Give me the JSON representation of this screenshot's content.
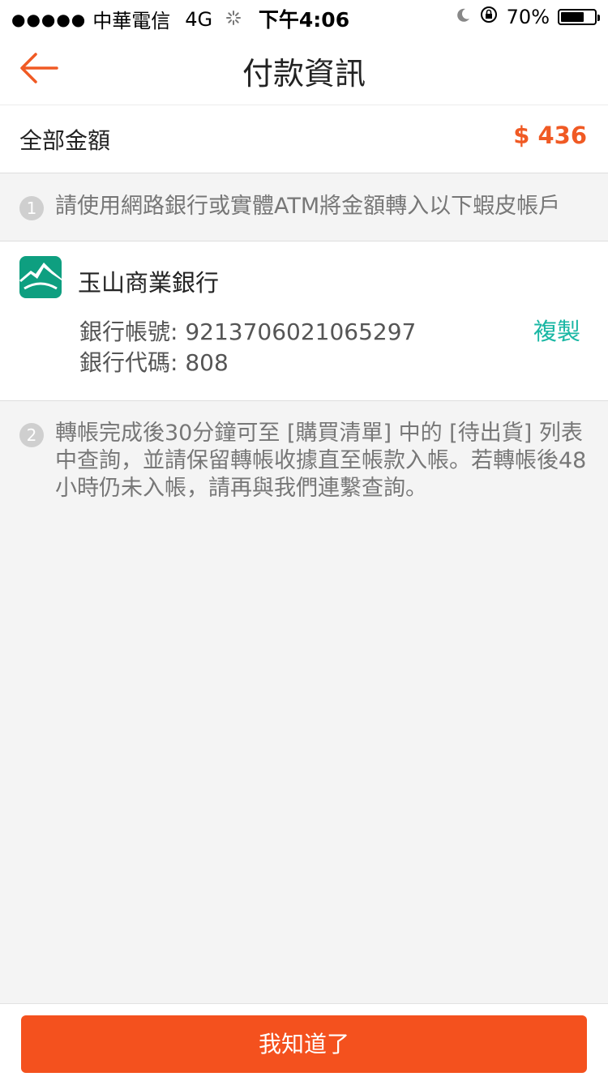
{
  "status_bar": {
    "signal": "●●●●●",
    "carrier": "中華電信",
    "network": "4G",
    "time": "下午4:06",
    "battery_text": "70%",
    "battery_level": 0.7
  },
  "header": {
    "title": "付款資訊",
    "back_icon": "arrow-left-icon",
    "accent_color": "#f05a24"
  },
  "total": {
    "label": "全部金額",
    "amount": "$ 436"
  },
  "step1": {
    "number": "1",
    "text": "請使用網路銀行或實體ATM將金額轉入以下蝦皮帳戶"
  },
  "bank": {
    "name": "玉山商業銀行",
    "logo_icon": "esun-bank-logo",
    "account": "銀行帳號: 9213706021065297",
    "code": "銀行代碼: 808",
    "copy_label": "複製",
    "logo_color": "#0e9f80"
  },
  "step2": {
    "number": "2",
    "text": "轉帳完成後30分鐘可至 [購買清單] 中的 [待出貨] 列表中查詢，並請保留轉帳收據直至帳款入帳。若轉帳後48小時仍未入帳，請再與我們連繫查詢。"
  },
  "footer": {
    "confirm_label": "我知道了",
    "button_color": "#f4511e"
  }
}
